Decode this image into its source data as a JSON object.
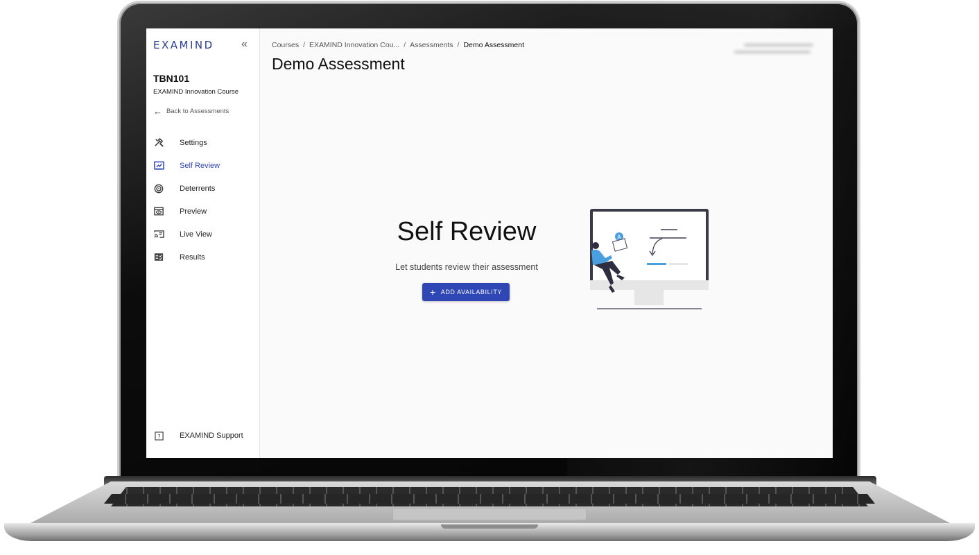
{
  "app": {
    "logo_text": "EXAMIND",
    "collapse_icon": "double-chevron-left-icon"
  },
  "course": {
    "code": "TBN101",
    "name": "EXAMIND Innovation Course",
    "back_label": "Back to Assessments"
  },
  "sidebar": {
    "items": [
      {
        "label": "Settings",
        "icon": "tools-icon",
        "active": false
      },
      {
        "label": "Self Review",
        "icon": "self-review-icon",
        "active": true
      },
      {
        "label": "Deterrents",
        "icon": "target-icon",
        "active": false
      },
      {
        "label": "Preview",
        "icon": "eye-window-icon",
        "active": false
      },
      {
        "label": "Live View",
        "icon": "cast-icon",
        "active": false
      },
      {
        "label": "Results",
        "icon": "checklist-icon",
        "active": false
      }
    ],
    "support_label": "EXAMIND Support"
  },
  "breadcrumb": {
    "items": [
      "Courses",
      "EXAMIND Innovation Cou...",
      "Assessments",
      "Demo Assessment"
    ],
    "separator": "/"
  },
  "page": {
    "title": "Demo Assessment"
  },
  "empty_state": {
    "title": "Self Review",
    "subtitle": "Let students review their assessment",
    "button_label": "ADD AVAILABILITY"
  },
  "colors": {
    "accent": "#2f46b5",
    "brand": "#2a3c8f",
    "illustration_blue": "#4a9fe0"
  }
}
